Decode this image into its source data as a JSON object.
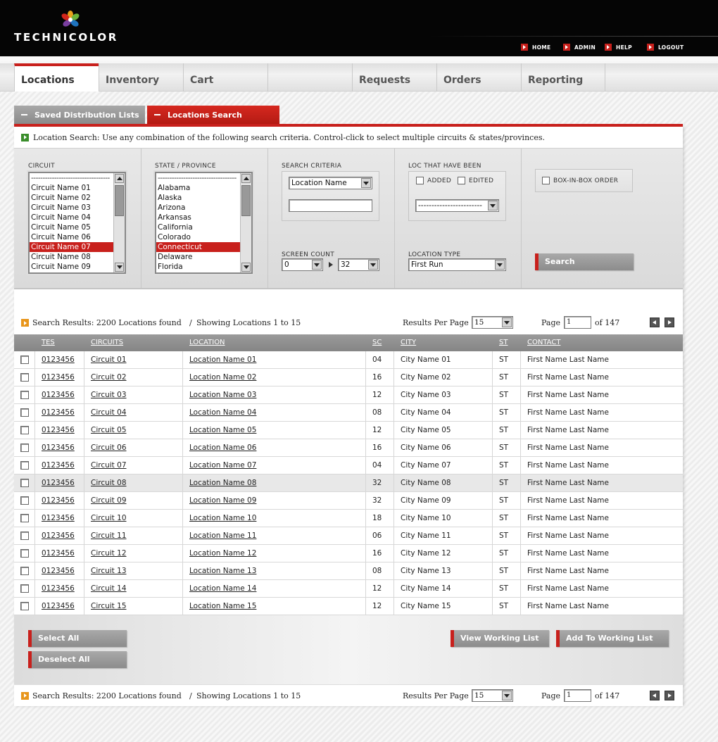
{
  "header": {
    "logo_text": "TECHNICOLOR",
    "links": [
      "HOME",
      "ADMIN",
      "HELP",
      "LOGOUT"
    ]
  },
  "nav": {
    "tabs": [
      "Locations",
      "Inventory",
      "Cart",
      "",
      "Requests",
      "Orders",
      "Reporting"
    ],
    "active": "Locations"
  },
  "section_tabs": {
    "saved": "Saved Distribution Lists",
    "search": "Locations Search"
  },
  "instructions": "Location Search: Use any combination of the following search criteria. Control-click to select multiple circuits & states/provinces.",
  "criteria": {
    "circuit_label": "CIRCUIT",
    "circuit_options": [
      "----------------------------------",
      "Circuit Name 01",
      "Circuit Name 02",
      "Circuit Name 03",
      "Circuit Name 04",
      "Circuit Name 05",
      "Circuit Name 06",
      "Circuit Name 07",
      "Circuit Name 08",
      "Circuit Name 09"
    ],
    "circuit_selected": "Circuit Name 07",
    "state_label": "STATE / PROVINCE",
    "state_options": [
      "----------------------------------",
      "Alabama",
      "Alaska",
      "Arizona",
      "Arkansas",
      "California",
      "Colorado",
      "Connecticut",
      "Delaware",
      "Florida"
    ],
    "state_selected": "Connecticut",
    "search_criteria_label": "SEARCH CRITERIA",
    "search_criteria_value": "Location Name",
    "search_text_value": "",
    "screen_count_label": "SCREEN COUNT",
    "screen_count_from": "0",
    "screen_count_to": "32",
    "loc_been_label": "LOC THAT HAVE BEEN",
    "added_label": "ADDED",
    "edited_label": "EDITED",
    "loc_been_select": "------------------------",
    "location_type_label": "LOCATION TYPE",
    "location_type_value": "First Run",
    "box_in_box_label": "BOX-IN-BOX ORDER",
    "search_button": "Search"
  },
  "results": {
    "summary": "Search Results: 2200 Locations found",
    "showing": "Showing Locations 1 to 15",
    "separator": "/",
    "per_page_label": "Results Per Page",
    "per_page_value": "15",
    "page_label": "Page",
    "page_value": "1",
    "of_label": "of 147"
  },
  "table": {
    "headers": [
      "TES",
      "CIRCUITS",
      "LOCATION",
      "SC",
      "CITY",
      "ST",
      "CONTACT"
    ],
    "highlighted_row": 7,
    "rows": [
      [
        "0123456",
        "Circuit 01",
        "Location Name 01",
        "04",
        "City Name 01",
        "ST",
        "First Name Last Name"
      ],
      [
        "0123456",
        "Circuit 02",
        "Location Name 02",
        "16",
        "City Name 02",
        "ST",
        "First Name Last Name"
      ],
      [
        "0123456",
        "Circuit 03",
        "Location Name 03",
        "12",
        "City Name 03",
        "ST",
        "First Name Last Name"
      ],
      [
        "0123456",
        "Circuit 04",
        "Location Name 04",
        "08",
        "City Name 04",
        "ST",
        "First Name Last Name"
      ],
      [
        "0123456",
        "Circuit 05",
        "Location Name 05",
        "12",
        "City Name 05",
        "ST",
        "First Name Last Name"
      ],
      [
        "0123456",
        "Circuit 06",
        "Location Name 06",
        "16",
        "City Name 06",
        "ST",
        "First Name Last Name"
      ],
      [
        "0123456",
        "Circuit 07",
        "Location Name 07",
        "04",
        "City Name 07",
        "ST",
        "First Name Last Name"
      ],
      [
        "0123456",
        "Circuit 08",
        "Location Name 08",
        "32",
        "City Name 08",
        "ST",
        "First Name Last Name"
      ],
      [
        "0123456",
        "Circuit 09",
        "Location Name 09",
        "32",
        "City Name 09",
        "ST",
        "First Name Last Name"
      ],
      [
        "0123456",
        "Circuit 10",
        "Location Name 10",
        "18",
        "City Name 10",
        "ST",
        "First Name Last Name"
      ],
      [
        "0123456",
        "Circuit 11",
        "Location Name 11",
        "06",
        "City Name 11",
        "ST",
        "First Name Last Name"
      ],
      [
        "0123456",
        "Circuit 12",
        "Location Name 12",
        "16",
        "City Name 12",
        "ST",
        "First Name Last Name"
      ],
      [
        "0123456",
        "Circuit 13",
        "Location Name 13",
        "08",
        "City Name 13",
        "ST",
        "First Name Last Name"
      ],
      [
        "0123456",
        "Circuit 14",
        "Location Name 14",
        "12",
        "City Name 14",
        "ST",
        "First Name Last Name"
      ],
      [
        "0123456",
        "Circuit 15",
        "Location Name 15",
        "12",
        "City Name 15",
        "ST",
        "First Name Last Name"
      ]
    ]
  },
  "actions": {
    "select_all": "Select All",
    "deselect_all": "Deselect All",
    "view_working_list": "View Working List",
    "add_to_working_list": "Add To Working List"
  },
  "colors": {
    "brand_red": "#c8201c",
    "header_black": "#050505",
    "button_gray": "#999999",
    "info_green": "#3a8d2b",
    "results_orange": "#e8961c"
  },
  "icons": {
    "logo": "color-petals-logo-icon",
    "top_links": "red-arrow-icon",
    "instructions": "green-arrow-icon",
    "results": "orange-arrow-icon",
    "pager": [
      "prev-page-icon",
      "next-page-icon"
    ]
  }
}
